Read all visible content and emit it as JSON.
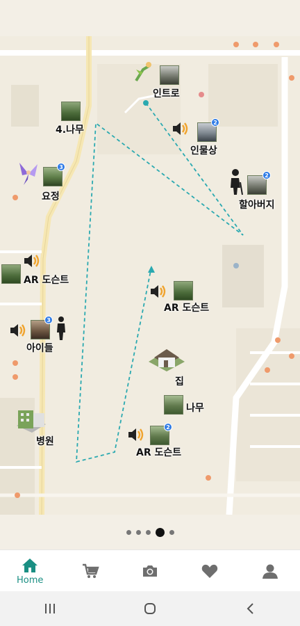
{
  "map": {
    "markers": [
      {
        "id": "intro",
        "label": "인트로",
        "badge": ""
      },
      {
        "id": "tree4",
        "label": "4.나무",
        "badge": ""
      },
      {
        "id": "statue",
        "label": "인물상",
        "badge": "2"
      },
      {
        "id": "fairy",
        "label": "요정",
        "badge": "3"
      },
      {
        "id": "grandpa",
        "label": "할아버지",
        "badge": "2"
      },
      {
        "id": "ar1",
        "label": "AR 도슨트",
        "badge": ""
      },
      {
        "id": "ar2",
        "label": "AR 도슨트",
        "badge": ""
      },
      {
        "id": "kids",
        "label": "아이들",
        "badge": "3"
      },
      {
        "id": "house",
        "label": "집",
        "badge": ""
      },
      {
        "id": "tree",
        "label": "나무",
        "badge": ""
      },
      {
        "id": "hospital",
        "label": "병원",
        "badge": ""
      },
      {
        "id": "ar3",
        "label": "AR 도슨트",
        "badge": "2"
      }
    ]
  },
  "pager": {
    "total": 5,
    "active_index": 3
  },
  "bottom_nav": {
    "items": [
      {
        "id": "home",
        "label": "Home",
        "icon": "home-icon",
        "active": true
      },
      {
        "id": "shop",
        "label": "",
        "icon": "cart-icon",
        "active": false
      },
      {
        "id": "camera",
        "label": "",
        "icon": "camera-icon",
        "active": false
      },
      {
        "id": "favorites",
        "label": "",
        "icon": "heart-icon",
        "active": false
      },
      {
        "id": "profile",
        "label": "",
        "icon": "user-icon",
        "active": false
      }
    ],
    "active_color": "#1a8f83",
    "inactive_color": "#6e6e6e"
  },
  "system_nav": {
    "buttons": [
      "recent-apps-icon",
      "home-circle-icon",
      "back-icon"
    ]
  }
}
